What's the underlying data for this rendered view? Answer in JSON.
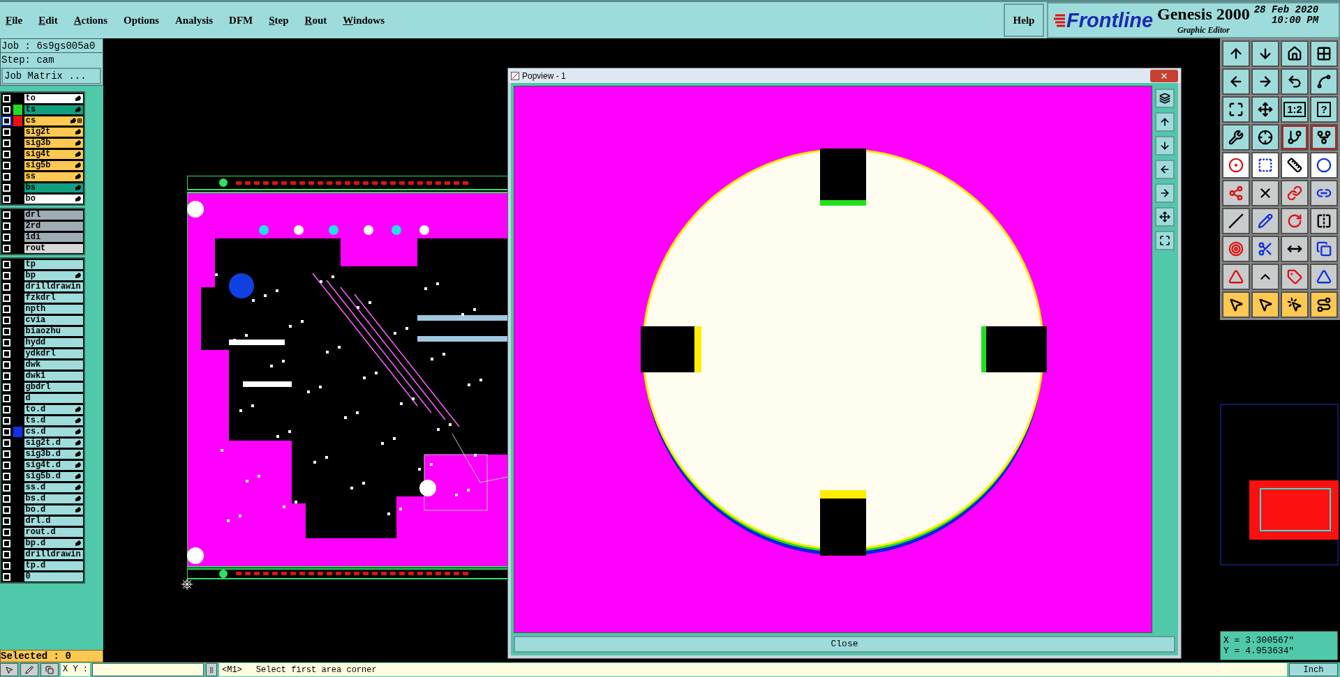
{
  "menu": [
    {
      "label": "File",
      "mnemonic": true
    },
    {
      "label": "Edit",
      "mnemonic": true
    },
    {
      "label": "Actions",
      "mnemonic": true
    },
    {
      "label": "Options",
      "mnemonic": false
    },
    {
      "label": "Analysis",
      "mnemonic": false
    },
    {
      "label": "DFM",
      "mnemonic": false
    },
    {
      "label": "Step",
      "mnemonic": true
    },
    {
      "label": "Rout",
      "mnemonic": true
    },
    {
      "label": "Windows",
      "mnemonic": true
    }
  ],
  "help": "Help",
  "brand": {
    "logo": "Frontline",
    "product": "Genesis 2000",
    "date": "28 Feb 2020",
    "time": "10:00 PM",
    "subtitle": "Graphic Editor"
  },
  "job": {
    "job": "Job : 6s9gs005a0",
    "step": "Step: cam",
    "matrix_button": "Job Matrix ..."
  },
  "layer_groups": [
    [
      {
        "name": "to",
        "kind": "board",
        "affected": true,
        "checked": false,
        "selected": false
      },
      {
        "name": "ts",
        "kind": "solder_mask",
        "affected": true,
        "checked": false,
        "selected": false,
        "color": "#22dd22"
      },
      {
        "name": "cs",
        "kind": "signal",
        "affected": true,
        "checked": false,
        "selected": true,
        "color": "#ee1111"
      },
      {
        "name": "sig2t",
        "kind": "signal",
        "affected": true,
        "checked": false,
        "selected": false
      },
      {
        "name": "sig3b",
        "kind": "signal",
        "affected": true,
        "checked": false,
        "selected": false
      },
      {
        "name": "sig4t",
        "kind": "signal",
        "affected": true,
        "checked": false,
        "selected": false
      },
      {
        "name": "sig5b",
        "kind": "signal",
        "affected": true,
        "checked": false,
        "selected": false
      },
      {
        "name": "ss",
        "kind": "signal",
        "affected": true,
        "checked": false,
        "selected": false
      },
      {
        "name": "bs",
        "kind": "solder_mask",
        "affected": true,
        "checked": false,
        "selected": false
      },
      {
        "name": "bo",
        "kind": "board",
        "affected": true,
        "checked": false,
        "selected": false
      }
    ],
    [
      {
        "name": "drl",
        "kind": "drill",
        "affected": false,
        "checked": false,
        "selected": false
      },
      {
        "name": "2rd",
        "kind": "drill",
        "affected": false,
        "checked": false,
        "selected": false
      },
      {
        "name": "1di",
        "kind": "drill",
        "affected": false,
        "checked": false,
        "selected": false
      },
      {
        "name": "rout",
        "kind": "rout",
        "affected": false,
        "checked": false,
        "selected": false
      }
    ],
    [
      {
        "name": "tp",
        "kind": "document",
        "affected": false,
        "checked": false,
        "selected": false
      },
      {
        "name": "bp",
        "kind": "document",
        "affected": true,
        "checked": false,
        "selected": false
      },
      {
        "name": "drilldrawin",
        "kind": "document",
        "affected": false,
        "checked": false,
        "selected": false
      },
      {
        "name": "fzkdrl",
        "kind": "document",
        "affected": false,
        "checked": false,
        "selected": false
      },
      {
        "name": "npth",
        "kind": "document",
        "affected": false,
        "checked": false,
        "selected": false
      },
      {
        "name": "cvia",
        "kind": "document",
        "affected": false,
        "checked": false,
        "selected": false
      },
      {
        "name": "biaozhu",
        "kind": "document",
        "affected": false,
        "checked": false,
        "selected": false
      },
      {
        "name": "hydd",
        "kind": "document",
        "affected": false,
        "checked": false,
        "selected": false
      },
      {
        "name": "ydkdrl",
        "kind": "document",
        "affected": false,
        "checked": false,
        "selected": false
      },
      {
        "name": "dwk",
        "kind": "document",
        "affected": false,
        "checked": false,
        "selected": false
      },
      {
        "name": "dwk1",
        "kind": "document",
        "affected": false,
        "checked": false,
        "selected": false
      },
      {
        "name": "gbdrl",
        "kind": "document",
        "affected": false,
        "checked": false,
        "selected": false
      },
      {
        "name": "d",
        "kind": "document",
        "affected": false,
        "checked": false,
        "selected": false
      },
      {
        "name": "to.d",
        "kind": "document",
        "affected": true,
        "checked": false,
        "selected": false
      },
      {
        "name": "ts.d",
        "kind": "document",
        "affected": true,
        "checked": false,
        "selected": false
      },
      {
        "name": "cs.d",
        "kind": "document",
        "affected": true,
        "checked": false,
        "selected": false,
        "color": "#1030ee"
      },
      {
        "name": "sig2t.d",
        "kind": "document",
        "affected": true,
        "checked": false,
        "selected": false
      },
      {
        "name": "sig3b.d",
        "kind": "document",
        "affected": true,
        "checked": false,
        "selected": false
      },
      {
        "name": "sig4t.d",
        "kind": "document",
        "affected": true,
        "checked": false,
        "selected": false
      },
      {
        "name": "sig5b.d",
        "kind": "document",
        "affected": true,
        "checked": false,
        "selected": false
      },
      {
        "name": "ss.d",
        "kind": "document",
        "affected": true,
        "checked": false,
        "selected": false
      },
      {
        "name": "bs.d",
        "kind": "document",
        "affected": true,
        "checked": false,
        "selected": false
      },
      {
        "name": "bo.d",
        "kind": "document",
        "affected": true,
        "checked": false,
        "selected": false
      },
      {
        "name": "drl.d",
        "kind": "document",
        "affected": false,
        "checked": false,
        "selected": false
      },
      {
        "name": "rout.d",
        "kind": "document",
        "affected": false,
        "checked": false,
        "selected": false
      },
      {
        "name": "bp.d",
        "kind": "document",
        "affected": true,
        "checked": false,
        "selected": false
      },
      {
        "name": "drilldrawin",
        "kind": "document",
        "affected": false,
        "checked": false,
        "selected": false
      },
      {
        "name": "tp.d",
        "kind": "document",
        "affected": false,
        "checked": false,
        "selected": false
      },
      {
        "name": "0",
        "kind": "document",
        "affected": false,
        "checked": false,
        "selected": false
      }
    ]
  ],
  "selected_count": "Selected : 0",
  "popview": {
    "title": "Popview - 1",
    "close": "Close"
  },
  "toolbar_labels": {
    "scale": "1:2",
    "help": "?"
  },
  "coordinates": {
    "x": "X = 3.300567\"",
    "y": "Y = 4.953634\""
  },
  "status": {
    "xy_label": "X Y :",
    "mouse": "<M1>",
    "prompt": "Select first area corner",
    "units": "Inch"
  }
}
